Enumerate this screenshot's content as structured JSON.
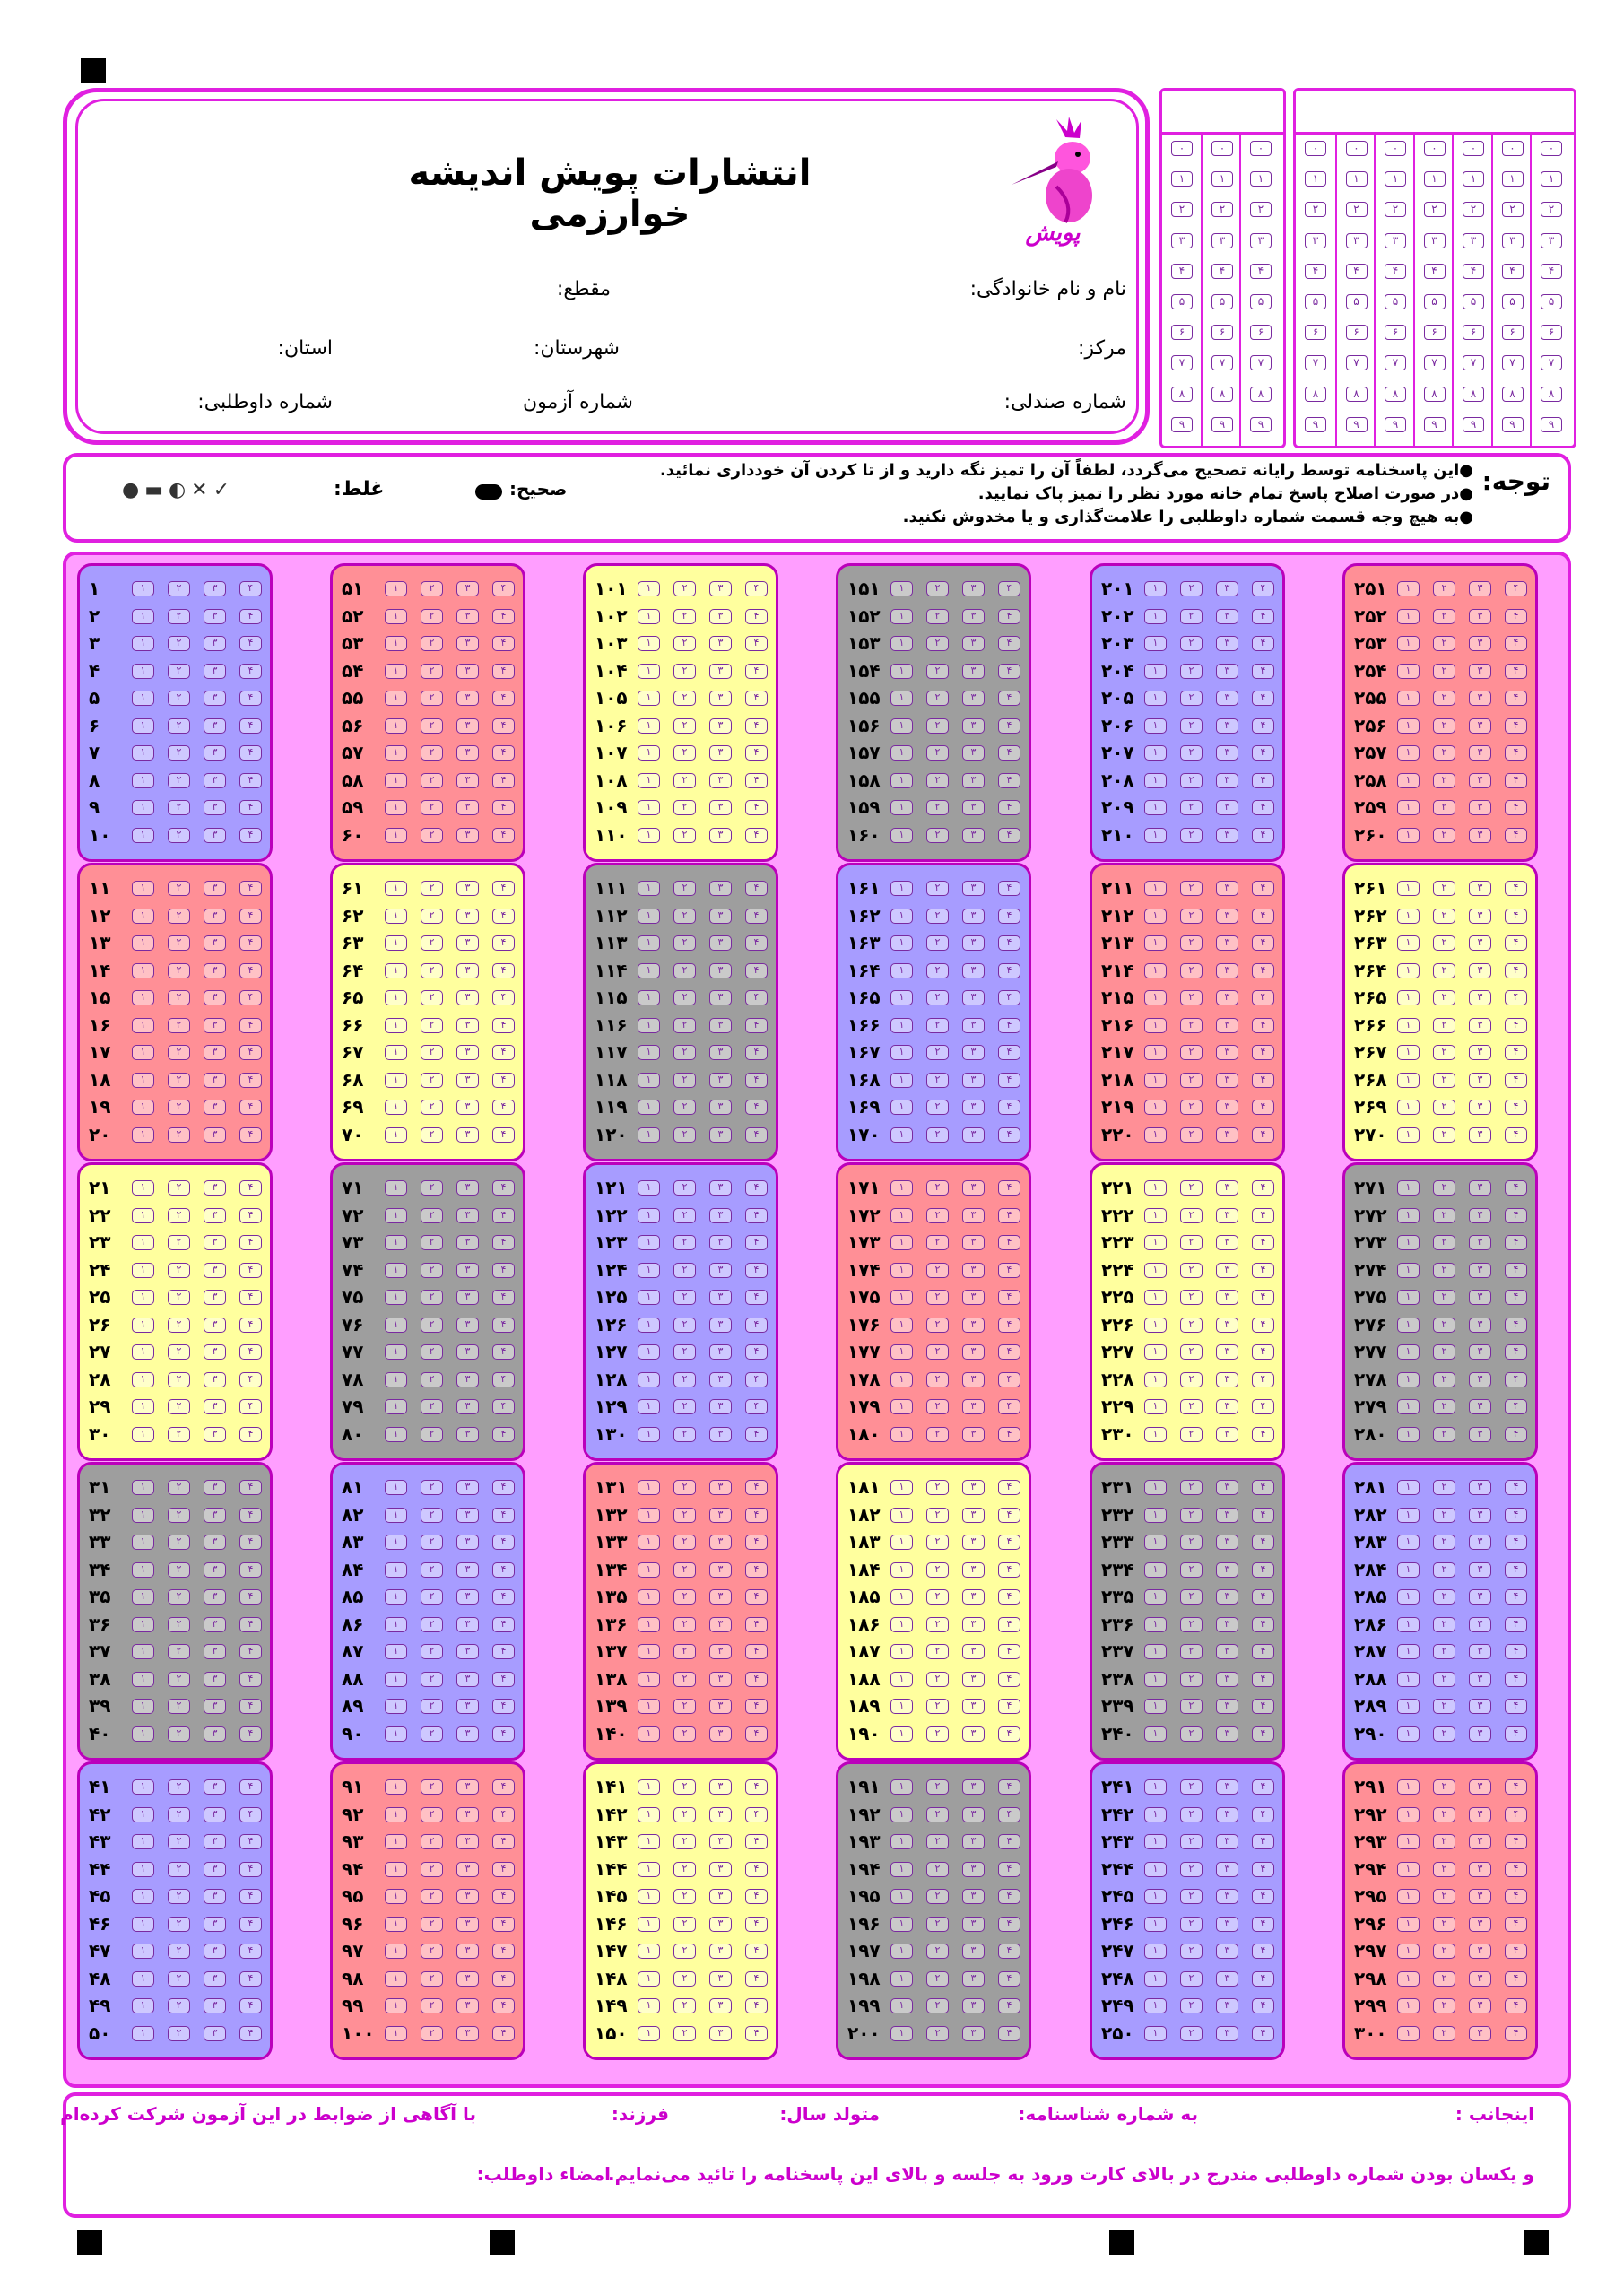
{
  "publisher": {
    "title": "انتشارات پویش اندیشه خوارزمی",
    "logo_text": "پویش"
  },
  "fields": {
    "name": "نام و نام خانوادگی:",
    "level": "مقطع:",
    "center": "مرکز:",
    "city": "شهرستان:",
    "province": "استان:",
    "seat": "شماره صندلی:",
    "exam": "شماره آزمون",
    "candidate": "شماره داوطلبی:"
  },
  "id_digits": [
    "۰",
    "۱",
    "۲",
    "۳",
    "۴",
    "۵",
    "۶",
    "۷",
    "۸",
    "۹"
  ],
  "notice": {
    "title": "توجه:",
    "lines": [
      "●این پاسخنامه توسط رایانه تصحیح می‌گردد، لطفاً آن را تمیز نگه دارید و از تا کردن آن خودداری نمائید.",
      "●در صورت اصلاح پاسخ تمام خانه مورد نظر را تمیز پاک نمایید.",
      "●به هیچ وجه قسمت شماره داوطلبی را علامت‌گذاری و یا مخدوش نکنید."
    ],
    "correct_label": "صحیح:",
    "wrong_label": "غلط:",
    "wrong_marks": "●▬◐✕✓"
  },
  "options": [
    "۱",
    "۲",
    "۳",
    "۴"
  ],
  "colors": {
    "pink": "#e020e0",
    "area": "#ff9eff",
    "blue": "#a79cff",
    "red": "#ff8f96",
    "yellow": "#ffff9e",
    "gray": "#9e9e9e"
  },
  "blocks": [
    {
      "start": 1,
      "color": "blue",
      "n": [
        "۱",
        "۲",
        "۳",
        "۴",
        "۵",
        "۶",
        "۷",
        "۸",
        "۹",
        "۱۰"
      ]
    },
    {
      "start": 11,
      "color": "red",
      "n": [
        "۱۱",
        "۱۲",
        "۱۳",
        "۱۴",
        "۱۵",
        "۱۶",
        "۱۷",
        "۱۸",
        "۱۹",
        "۲۰"
      ]
    },
    {
      "start": 21,
      "color": "yellow",
      "n": [
        "۲۱",
        "۲۲",
        "۲۳",
        "۲۴",
        "۲۵",
        "۲۶",
        "۲۷",
        "۲۸",
        "۲۹",
        "۳۰"
      ]
    },
    {
      "start": 31,
      "color": "gray",
      "n": [
        "۳۱",
        "۳۲",
        "۳۳",
        "۳۴",
        "۳۵",
        "۳۶",
        "۳۷",
        "۳۸",
        "۳۹",
        "۴۰"
      ]
    },
    {
      "start": 41,
      "color": "blue",
      "n": [
        "۴۱",
        "۴۲",
        "۴۳",
        "۴۴",
        "۴۵",
        "۴۶",
        "۴۷",
        "۴۸",
        "۴۹",
        "۵۰"
      ]
    },
    {
      "start": 51,
      "color": "red",
      "n": [
        "۵۱",
        "۵۲",
        "۵۳",
        "۵۴",
        "۵۵",
        "۵۶",
        "۵۷",
        "۵۸",
        "۵۹",
        "۶۰"
      ]
    },
    {
      "start": 61,
      "color": "yellow",
      "n": [
        "۶۱",
        "۶۲",
        "۶۳",
        "۶۴",
        "۶۵",
        "۶۶",
        "۶۷",
        "۶۸",
        "۶۹",
        "۷۰"
      ]
    },
    {
      "start": 71,
      "color": "gray",
      "n": [
        "۷۱",
        "۷۲",
        "۷۳",
        "۷۴",
        "۷۵",
        "۷۶",
        "۷۷",
        "۷۸",
        "۷۹",
        "۸۰"
      ]
    },
    {
      "start": 81,
      "color": "blue",
      "n": [
        "۸۱",
        "۸۲",
        "۸۳",
        "۸۴",
        "۸۵",
        "۸۶",
        "۸۷",
        "۸۸",
        "۸۹",
        "۹۰"
      ]
    },
    {
      "start": 91,
      "color": "red",
      "n": [
        "۹۱",
        "۹۲",
        "۹۳",
        "۹۴",
        "۹۵",
        "۹۶",
        "۹۷",
        "۹۸",
        "۹۹",
        "۱۰۰"
      ]
    },
    {
      "start": 101,
      "color": "yellow",
      "n": [
        "۱۰۱",
        "۱۰۲",
        "۱۰۳",
        "۱۰۴",
        "۱۰۵",
        "۱۰۶",
        "۱۰۷",
        "۱۰۸",
        "۱۰۹",
        "۱۱۰"
      ]
    },
    {
      "start": 111,
      "color": "gray",
      "n": [
        "۱۱۱",
        "۱۱۲",
        "۱۱۳",
        "۱۱۴",
        "۱۱۵",
        "۱۱۶",
        "۱۱۷",
        "۱۱۸",
        "۱۱۹",
        "۱۲۰"
      ]
    },
    {
      "start": 121,
      "color": "blue",
      "n": [
        "۱۲۱",
        "۱۲۲",
        "۱۲۳",
        "۱۲۴",
        "۱۲۵",
        "۱۲۶",
        "۱۲۷",
        "۱۲۸",
        "۱۲۹",
        "۱۳۰"
      ]
    },
    {
      "start": 131,
      "color": "red",
      "n": [
        "۱۳۱",
        "۱۳۲",
        "۱۳۳",
        "۱۳۴",
        "۱۳۵",
        "۱۳۶",
        "۱۳۷",
        "۱۳۸",
        "۱۳۹",
        "۱۴۰"
      ]
    },
    {
      "start": 141,
      "color": "yellow",
      "n": [
        "۱۴۱",
        "۱۴۲",
        "۱۴۳",
        "۱۴۴",
        "۱۴۵",
        "۱۴۶",
        "۱۴۷",
        "۱۴۸",
        "۱۴۹",
        "۱۵۰"
      ]
    },
    {
      "start": 151,
      "color": "gray",
      "n": [
        "۱۵۱",
        "۱۵۲",
        "۱۵۳",
        "۱۵۴",
        "۱۵۵",
        "۱۵۶",
        "۱۵۷",
        "۱۵۸",
        "۱۵۹",
        "۱۶۰"
      ]
    },
    {
      "start": 161,
      "color": "blue",
      "n": [
        "۱۶۱",
        "۱۶۲",
        "۱۶۳",
        "۱۶۴",
        "۱۶۵",
        "۱۶۶",
        "۱۶۷",
        "۱۶۸",
        "۱۶۹",
        "۱۷۰"
      ]
    },
    {
      "start": 171,
      "color": "red",
      "n": [
        "۱۷۱",
        "۱۷۲",
        "۱۷۳",
        "۱۷۴",
        "۱۷۵",
        "۱۷۶",
        "۱۷۷",
        "۱۷۸",
        "۱۷۹",
        "۱۸۰"
      ]
    },
    {
      "start": 181,
      "color": "yellow",
      "n": [
        "۱۸۱",
        "۱۸۲",
        "۱۸۳",
        "۱۸۴",
        "۱۸۵",
        "۱۸۶",
        "۱۸۷",
        "۱۸۸",
        "۱۸۹",
        "۱۹۰"
      ]
    },
    {
      "start": 191,
      "color": "gray",
      "n": [
        "۱۹۱",
        "۱۹۲",
        "۱۹۳",
        "۱۹۴",
        "۱۹۵",
        "۱۹۶",
        "۱۹۷",
        "۱۹۸",
        "۱۹۹",
        "۲۰۰"
      ]
    },
    {
      "start": 201,
      "color": "blue",
      "n": [
        "۲۰۱",
        "۲۰۲",
        "۲۰۳",
        "۲۰۴",
        "۲۰۵",
        "۲۰۶",
        "۲۰۷",
        "۲۰۸",
        "۲۰۹",
        "۲۱۰"
      ]
    },
    {
      "start": 211,
      "color": "red",
      "n": [
        "۲۱۱",
        "۲۱۲",
        "۲۱۳",
        "۲۱۴",
        "۲۱۵",
        "۲۱۶",
        "۲۱۷",
        "۲۱۸",
        "۲۱۹",
        "۲۲۰"
      ]
    },
    {
      "start": 221,
      "color": "yellow",
      "n": [
        "۲۲۱",
        "۲۲۲",
        "۲۲۳",
        "۲۲۴",
        "۲۲۵",
        "۲۲۶",
        "۲۲۷",
        "۲۲۸",
        "۲۲۹",
        "۲۳۰"
      ]
    },
    {
      "start": 231,
      "color": "gray",
      "n": [
        "۲۳۱",
        "۲۳۲",
        "۲۳۳",
        "۲۳۴",
        "۲۳۵",
        "۲۳۶",
        "۲۳۷",
        "۲۳۸",
        "۲۳۹",
        "۲۴۰"
      ]
    },
    {
      "start": 241,
      "color": "blue",
      "n": [
        "۲۴۱",
        "۲۴۲",
        "۲۴۳",
        "۲۴۴",
        "۲۴۵",
        "۲۴۶",
        "۲۴۷",
        "۲۴۸",
        "۲۴۹",
        "۲۵۰"
      ]
    },
    {
      "start": 251,
      "color": "red",
      "n": [
        "۲۵۱",
        "۲۵۲",
        "۲۵۳",
        "۲۵۴",
        "۲۵۵",
        "۲۵۶",
        "۲۵۷",
        "۲۵۸",
        "۲۵۹",
        "۲۶۰"
      ]
    },
    {
      "start": 261,
      "color": "yellow",
      "n": [
        "۲۶۱",
        "۲۶۲",
        "۲۶۳",
        "۲۶۴",
        "۲۶۵",
        "۲۶۶",
        "۲۶۷",
        "۲۶۸",
        "۲۶۹",
        "۲۷۰"
      ]
    },
    {
      "start": 271,
      "color": "gray",
      "n": [
        "۲۷۱",
        "۲۷۲",
        "۲۷۳",
        "۲۷۴",
        "۲۷۵",
        "۲۷۶",
        "۲۷۷",
        "۲۷۸",
        "۲۷۹",
        "۲۸۰"
      ]
    },
    {
      "start": 281,
      "color": "blue",
      "n": [
        "۲۸۱",
        "۲۸۲",
        "۲۸۳",
        "۲۸۴",
        "۲۸۵",
        "۲۸۶",
        "۲۸۷",
        "۲۸۸",
        "۲۸۹",
        "۲۹۰"
      ]
    },
    {
      "start": 291,
      "color": "red",
      "n": [
        "۲۹۱",
        "۲۹۲",
        "۲۹۳",
        "۲۹۴",
        "۲۹۵",
        "۲۹۶",
        "۲۹۷",
        "۲۹۸",
        "۲۹۹",
        "۳۰۰"
      ]
    }
  ],
  "footer": {
    "i": "اینجانب :",
    "id_no": "به شماره شناسنامه:",
    "born": "متولد سال:",
    "child": "فرزند:",
    "aware": "با آگاهی از ضوابط در این آزمون شرکت کرده‌ام",
    "confirm": "و یکسان بودن شماره داوطلبی مندرج در بالای کارت ورود به جلسه و بالای این پاسخنامه را تائید می‌نمایم.",
    "signature": "امضاء داوطلب:"
  }
}
